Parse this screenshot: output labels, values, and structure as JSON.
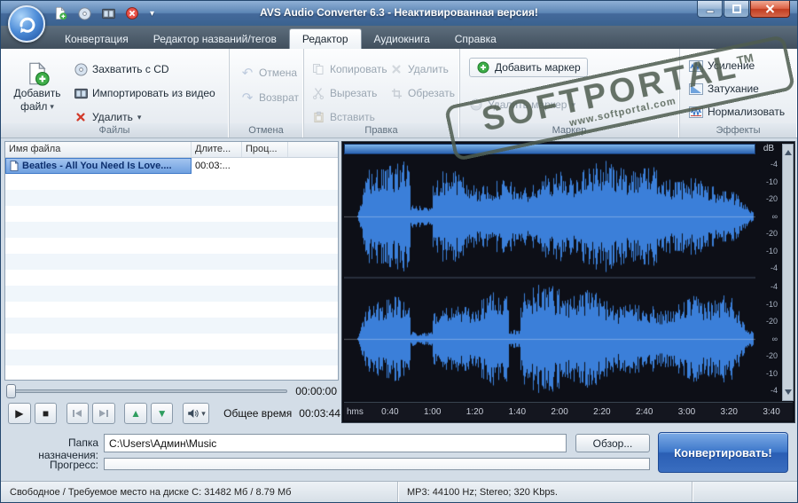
{
  "window": {
    "title": "AVS Audio Converter  6.3 - Неактивированная версия!"
  },
  "glyphs": {
    "dropdown": "▾",
    "play": "▶",
    "stop": "■",
    "up": "▲",
    "down": "▼",
    "undo": "↶",
    "redo": "↷",
    "db_unit": "dB",
    "time_unit": "hms"
  },
  "tabs": [
    {
      "label": "Конвертация"
    },
    {
      "label": "Редактор названий/тегов"
    },
    {
      "label": "Редактор",
      "active": true
    },
    {
      "label": "Аудиокнига"
    },
    {
      "label": "Справка"
    }
  ],
  "ribbon": {
    "files": {
      "group_label": "Файлы",
      "add_file_line1": "Добавить",
      "add_file_line2": "файл",
      "capture_cd": "Захватить с CD",
      "import_video": "Импортировать из видео",
      "delete": "Удалить"
    },
    "undo": {
      "group_label": "Отмена",
      "undo": "Отмена",
      "redo": "Возврат"
    },
    "edit": {
      "group_label": "Правка",
      "copy": "Копировать",
      "cut": "Вырезать",
      "paste": "Вставить",
      "delete": "Удалить",
      "trim": "Обрезать"
    },
    "marker": {
      "group_label": "Маркер",
      "add": "Добавить маркер",
      "remove": "Удалить маркер"
    },
    "effects": {
      "group_label": "Эффекты",
      "amplify": "Усиление",
      "fade": "Затухание",
      "normalize": "Нормализовать"
    }
  },
  "filelist": {
    "columns": [
      "Имя файла",
      "Длите...",
      "Проц..."
    ],
    "rows": [
      {
        "name": "Beatles - All You Need Is Love....",
        "duration": "00:03:..."
      }
    ]
  },
  "player": {
    "position_time": "00:00:00",
    "total_label": "Общее время",
    "total_time": "00:03:44"
  },
  "waveform": {
    "db_labels": [
      "-4",
      "-10",
      "-20",
      "∞",
      "-20",
      "-10",
      "-4"
    ],
    "time_ticks": [
      "0:40",
      "1:00",
      "1:20",
      "1:40",
      "2:00",
      "2:20",
      "2:40",
      "3:00",
      "3:20",
      "3:40"
    ],
    "color": "#3b7fd9",
    "bg": "#0d0f17"
  },
  "output": {
    "dest_label": "Папка назначения:",
    "dest_path": "C:\\Users\\Админ\\Music",
    "browse_label": "Обзор...",
    "convert_label": "Конвертировать!",
    "progress_label": "Прогресс:"
  },
  "statusbar": {
    "disk": "Свободное / Требуемое место на диске C: 31482 Мб / 8.79 Мб",
    "format": "MP3: 44100  Hz; Stereo; 320 Kbps."
  },
  "watermark": {
    "text": "SOFTPORTAL",
    "tm": "TM",
    "url": "www.softportal.com"
  }
}
